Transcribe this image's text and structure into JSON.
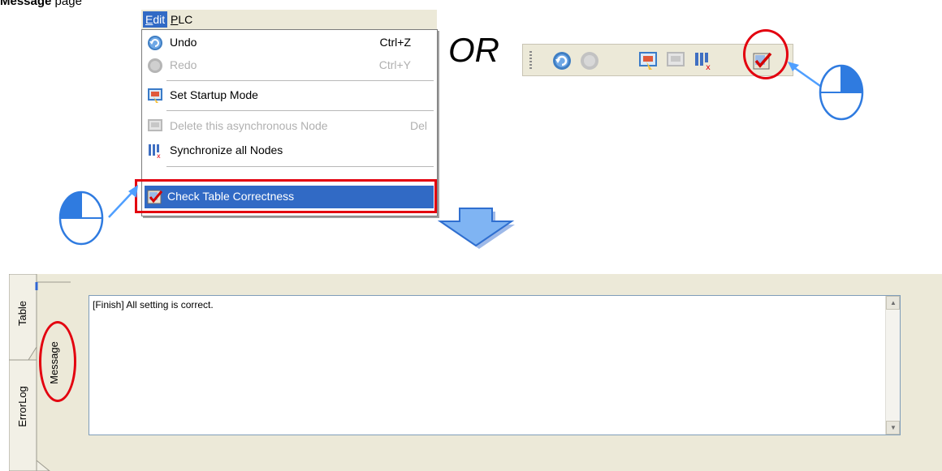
{
  "heading": {
    "bold": "Message",
    "rest": " page"
  },
  "menubar": {
    "edit": "Edit",
    "edit_u": "E",
    "plc": "PLC",
    "plc_u": "P"
  },
  "menu": {
    "undo": {
      "label": "Undo",
      "shortcut": "Ctrl+Z"
    },
    "redo": {
      "label": "Redo",
      "shortcut": "Ctrl+Y"
    },
    "startup": {
      "label": "Set Startup Mode"
    },
    "delete": {
      "label": "Delete this asynchronous Node",
      "shortcut": "Del"
    },
    "sync": {
      "label": "Synchronize all Nodes"
    },
    "check": {
      "label": "Check Table Correctness"
    }
  },
  "or_text": "OR",
  "tabs": {
    "table": "Table",
    "errorlog": "ErrorLog",
    "message": "Message"
  },
  "message_text": "[Finish] All setting is correct.",
  "colors": {
    "highlight": "#316ac5",
    "annotation": "#e3000f",
    "arrow": "#4f9fff"
  },
  "icons": [
    "undo-icon",
    "redo-icon",
    "startup-mode-icon",
    "delete-node-icon",
    "sync-nodes-icon",
    "check-table-icon",
    "mouse-click-icon",
    "down-arrow-icon",
    "scroll-up-icon",
    "scroll-down-icon"
  ]
}
